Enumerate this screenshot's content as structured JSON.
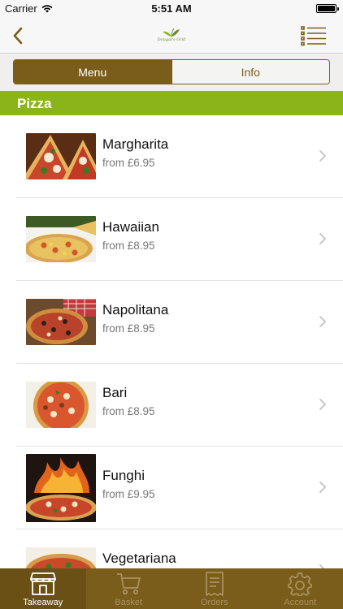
{
  "status": {
    "carrier": "Carrier",
    "time": "5:51 AM"
  },
  "nav": {
    "logo_text": "Dougal's Grill"
  },
  "segments": {
    "menu": "Menu",
    "info": "Info",
    "selected": "Menu"
  },
  "section": {
    "title": "Pizza"
  },
  "items": [
    {
      "name": "Margharita",
      "price": "from £6.95"
    },
    {
      "name": "Hawaiian",
      "price": "from £8.95"
    },
    {
      "name": "Napolitana",
      "price": "from £8.95"
    },
    {
      "name": "Bari",
      "price": "from £8.95"
    },
    {
      "name": "Funghi",
      "price": "from £9.95"
    },
    {
      "name": "Vegetariana",
      "price": ""
    }
  ],
  "tabs": [
    {
      "label": "Takeaway",
      "icon": "store-icon",
      "active": true
    },
    {
      "label": "Basket",
      "icon": "cart-icon",
      "active": false
    },
    {
      "label": "Orders",
      "icon": "receipt-icon",
      "active": false
    },
    {
      "label": "Account",
      "icon": "gear-icon",
      "active": false
    }
  ],
  "colors": {
    "brand_brown": "#7a5d1a",
    "section_green": "#8bb31a",
    "chevron_gray": "#c7c7cc"
  }
}
